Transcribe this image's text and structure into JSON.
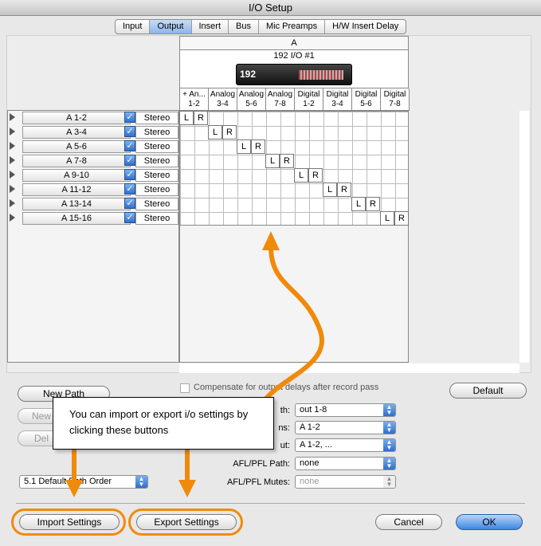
{
  "window": {
    "title": "I/O Setup"
  },
  "tabs": [
    {
      "label": "Input",
      "active": false
    },
    {
      "label": "Output",
      "active": true
    },
    {
      "label": "Insert",
      "active": false
    },
    {
      "label": "Bus",
      "active": false
    },
    {
      "label": "Mic Preamps",
      "active": false
    },
    {
      "label": "H/W Insert Delay",
      "active": false
    }
  ],
  "device": {
    "group": "A",
    "name": "192 I/O #1",
    "image_label": "192"
  },
  "channels": [
    {
      "line1": "+ An...",
      "line2": "1-2"
    },
    {
      "line1": "Analog",
      "line2": "3-4"
    },
    {
      "line1": "Analog",
      "line2": "5-6"
    },
    {
      "line1": "Analog",
      "line2": "7-8"
    },
    {
      "line1": "Digital",
      "line2": "1-2"
    },
    {
      "line1": "Digital",
      "line2": "3-4"
    },
    {
      "line1": "Digital",
      "line2": "5-6"
    },
    {
      "line1": "Digital",
      "line2": "7-8"
    }
  ],
  "paths": [
    {
      "name": "A 1-2",
      "format": "Stereo"
    },
    {
      "name": "A 3-4",
      "format": "Stereo"
    },
    {
      "name": "A 5-6",
      "format": "Stereo"
    },
    {
      "name": "A 7-8",
      "format": "Stereo"
    },
    {
      "name": "A 9-10",
      "format": "Stereo"
    },
    {
      "name": "A 11-12",
      "format": "Stereo"
    },
    {
      "name": "A 13-14",
      "format": "Stereo"
    },
    {
      "name": "A 15-16",
      "format": "Stereo"
    }
  ],
  "grid_labels": {
    "left": "L",
    "right": "R"
  },
  "compensate": {
    "label": "Compensate for output delays after record pass",
    "checked": false
  },
  "buttons": {
    "new_path": "New Path",
    "new_sub": "New",
    "delete": "Del",
    "default": "Default",
    "import": "Import Settings",
    "export": "Export Settings",
    "cancel": "Cancel",
    "ok": "OK"
  },
  "order_select": "5.1 Default Path Order",
  "settings": [
    {
      "label": "th:",
      "value": "out 1-8",
      "enabled": true
    },
    {
      "label": "ns:",
      "value": "A 1-2",
      "enabled": true
    },
    {
      "label": "ut:",
      "value": "A 1-2, ...",
      "enabled": true
    },
    {
      "label": "AFL/PFL Path:",
      "value": "none",
      "enabled": true
    },
    {
      "label": "AFL/PFL Mutes:",
      "value": "none",
      "enabled": false
    }
  ],
  "callout": {
    "text": "You can import or export i/o settings by clicking these buttons"
  },
  "colors": {
    "annotation": "#f08a0a",
    "selected_tab": "#8db6e8",
    "checkbox": "#2f6fcf"
  }
}
